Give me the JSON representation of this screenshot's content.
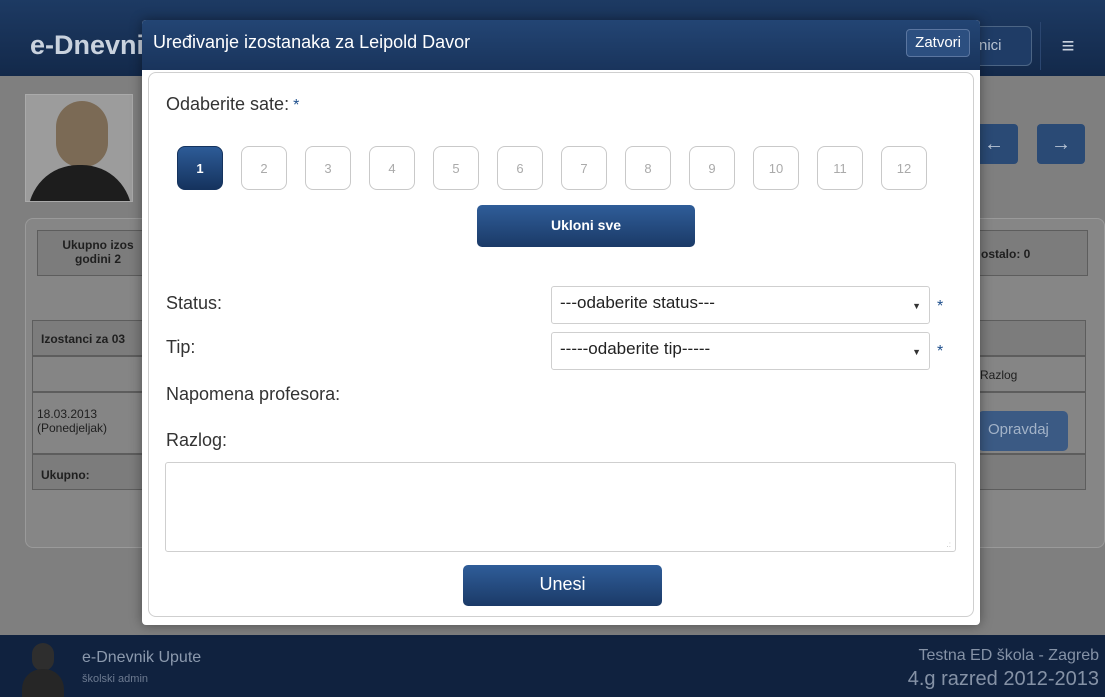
{
  "background": {
    "brand": "e-Dnevni",
    "top_button": "nici",
    "menu_icon": "≡",
    "arrow_left": "←",
    "arrow_right": "→",
    "summary_left": "Ukupno izos\ngodini 2",
    "summary_right": "ostalo: 0",
    "absences_header": "Izostanci za 03",
    "col_reason": "Razlog",
    "row_date": "18.03.2013\n(Ponedjeljak)",
    "total_label": "Ukupno:",
    "justify_button": "Opravdaj"
  },
  "footer": {
    "app_name": "e-Dnevnik Upute",
    "role": "školski admin",
    "school": "Testna ED škola - Zagreb",
    "class_year": "4.g razred 2012-2013"
  },
  "modal": {
    "title": "Uređivanje izostanaka za Leipold Davor",
    "close_label": "Zatvori",
    "hours_label": "Odaberite sate:",
    "required_mark": "*",
    "hours": [
      "1",
      "2",
      "3",
      "4",
      "5",
      "6",
      "7",
      "8",
      "9",
      "10",
      "11",
      "12"
    ],
    "selected_hour": "1",
    "remove_all_label": "Ukloni sve",
    "status_label": "Status:",
    "status_value": "---odaberite status---",
    "type_label": "Tip:",
    "type_value": "-----odaberite tip-----",
    "teacher_note_label": "Napomena profesora:",
    "reason_label": "Razlog:",
    "submit_label": "Unesi"
  }
}
